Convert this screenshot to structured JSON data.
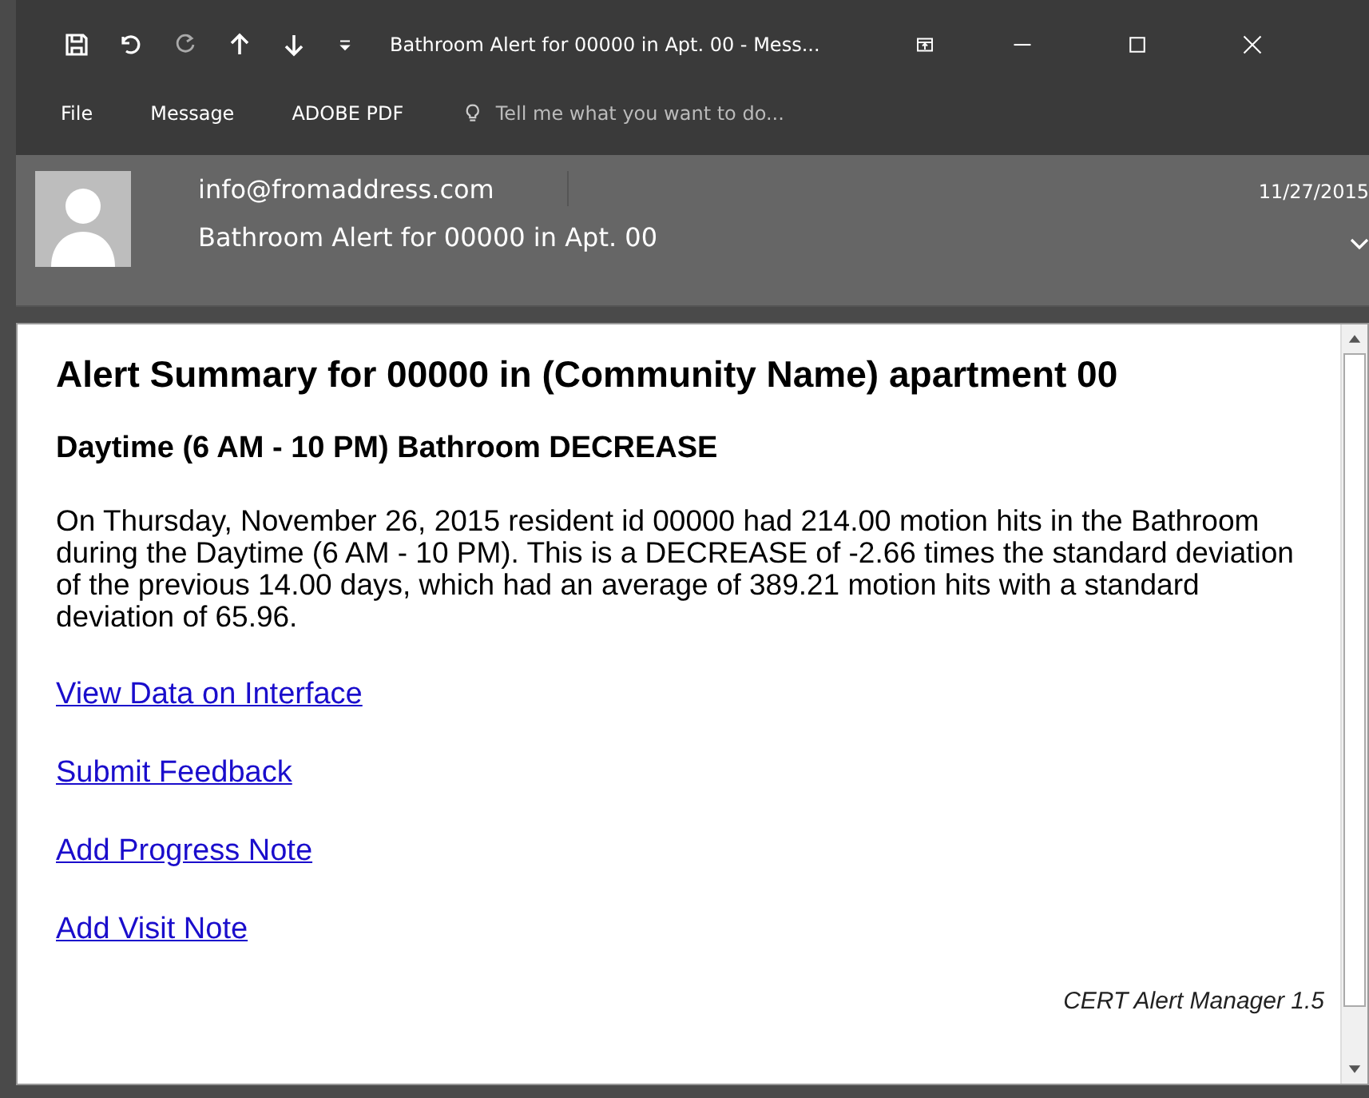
{
  "window": {
    "title": "Bathroom Alert for 00000 in Apt. 00 - Mess...",
    "search": {
      "placeholder": "Tell me what you want to do..."
    }
  },
  "menu": [
    {
      "label": "File"
    },
    {
      "label": "Message"
    },
    {
      "label": "ADOBE PDF"
    }
  ],
  "header": {
    "from": "info@fromaddress.com",
    "subject": "Bathroom Alert for 00000 in Apt. 00",
    "date": "11/27/2015"
  },
  "message": {
    "heading": "Alert Summary for 00000 in (Community Name) apartment 00",
    "subheading": "Daytime (6 AM - 10 PM) Bathroom DECREASE",
    "body": "On Thursday, November 26, 2015 resident id 00000 had 214.00 motion hits in the Bathroom during the Daytime (6 AM - 10 PM). This is a DECREASE of -2.66 times the standard deviation of the previous 14.00 days, which had an average of 389.21 motion hits with a standard deviation of 65.96.",
    "links": [
      "View Data on Interface",
      "Submit Feedback",
      "Add Progress Note",
      "Add Visit Note"
    ],
    "footer": "CERT Alert Manager 1.5"
  }
}
